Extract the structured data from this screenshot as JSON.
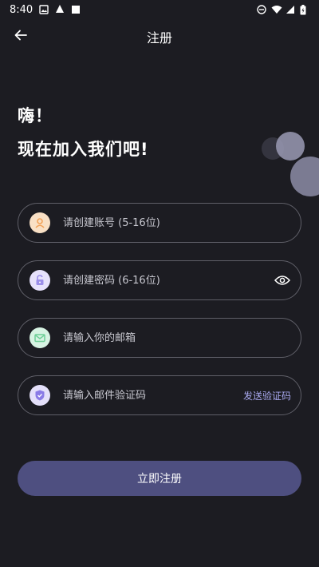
{
  "status_bar": {
    "time": "8:40"
  },
  "header": {
    "title": "注册"
  },
  "greeting": {
    "line1": "嗨！",
    "line2": "现在加入我们吧!"
  },
  "form": {
    "account": {
      "placeholder": "请创建账号 (5-16位)",
      "value": ""
    },
    "password": {
      "placeholder": "请创建密码 (6-16位)",
      "value": ""
    },
    "email": {
      "placeholder": "请输入你的邮箱",
      "value": ""
    },
    "code": {
      "placeholder": "请输入邮件验证码",
      "value": "",
      "send_label": "发送验证码"
    }
  },
  "submit": {
    "label": "立即注册"
  },
  "icons": {
    "back": "arrow-left-icon",
    "account": "user-icon",
    "password": "unlock-icon",
    "email": "mail-icon",
    "code": "shield-icon",
    "eye": "eye-icon"
  },
  "colors": {
    "background": "#1c1c22",
    "border": "#5f5f68",
    "button": "#4e4f80",
    "link": "#a9a9f0",
    "user_icon": "#f2a35a",
    "lock_icon": "#9b8ee8",
    "mail_icon": "#6fcf97",
    "shield_icon": "#8a7be6"
  }
}
